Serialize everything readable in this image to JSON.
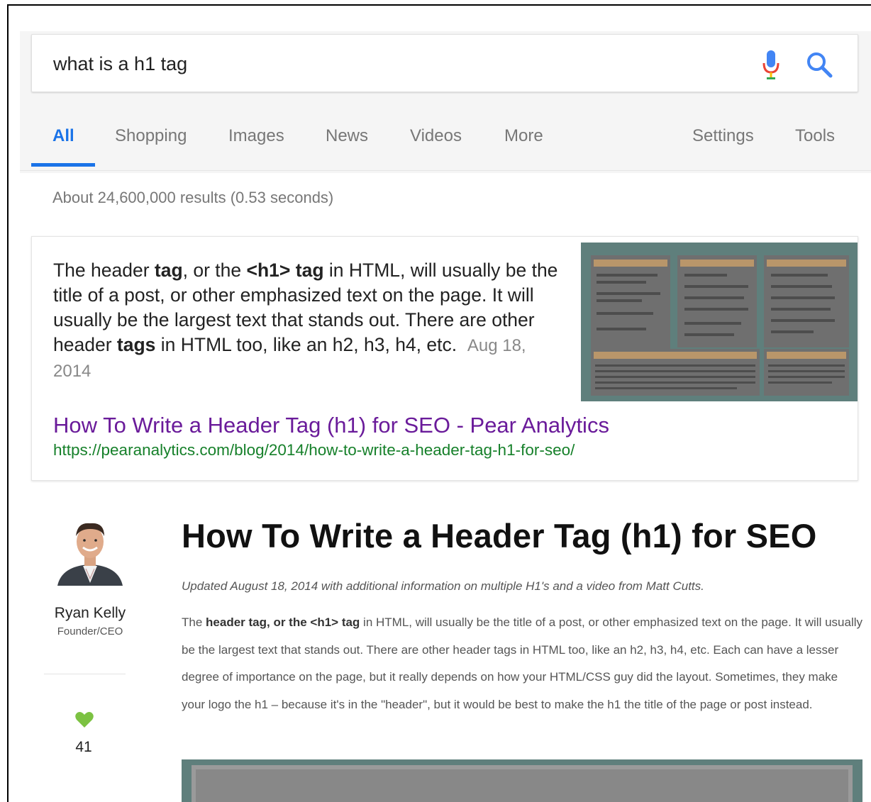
{
  "search": {
    "query": "what is a h1 tag"
  },
  "tabs": [
    {
      "label": "All",
      "active": true
    },
    {
      "label": "Shopping"
    },
    {
      "label": "Images"
    },
    {
      "label": "News"
    },
    {
      "label": "Videos"
    },
    {
      "label": "More"
    },
    {
      "label": "Settings"
    },
    {
      "label": "Tools"
    }
  ],
  "results_stats": "About 24,600,000 results (0.53 seconds)",
  "featured_snippet": {
    "text_parts": {
      "p1": "The header ",
      "b1": "tag",
      "p2": ", or the ",
      "b2": "<h1> tag",
      "p3": " in HTML, will usually be the title of a post, or other emphasized text on the page. It will usually be the largest text that stands out. There are other header ",
      "b3": "tags",
      "p4": " in HTML too, like an h2, h3, h4, etc."
    },
    "date": "Aug 18, 2014",
    "title": "How To Write a Header Tag (h1) for SEO - Pear Analytics",
    "url": "https://pearanalytics.com/blog/2014/how-to-write-a-header-tag-h1-for-seo/"
  },
  "author": {
    "name": "Ryan Kelly",
    "role": "Founder/CEO",
    "likes": "41"
  },
  "article": {
    "title": "How To Write a Header Tag (h1) for SEO",
    "updated": "Updated August 18, 2014 with additional information on multiple H1's and a video from Matt Cutts.",
    "body": {
      "p1": "The ",
      "b1": "header tag, or the <h1> tag",
      "p2": " in HTML, will usually be the title of a post, or other emphasized text on the page. It will usually be the largest text that stands out.  There are other header tags in HTML too, like an h2, h3, h4, etc. Each can have a lesser degree of importance on the page, but it really depends on how your HTML/CSS guy did the layout.  Sometimes, they make your logo the h1 – because it's in the \"header\", but it would be best to make the h1 the title of the page or post instead."
    }
  },
  "colors": {
    "accent_blue": "#1a73e8",
    "visited_link": "#6a1b9a",
    "url_green": "#16802a",
    "heart_green": "#7cc242",
    "thumb_teal": "#5f7f7c"
  }
}
